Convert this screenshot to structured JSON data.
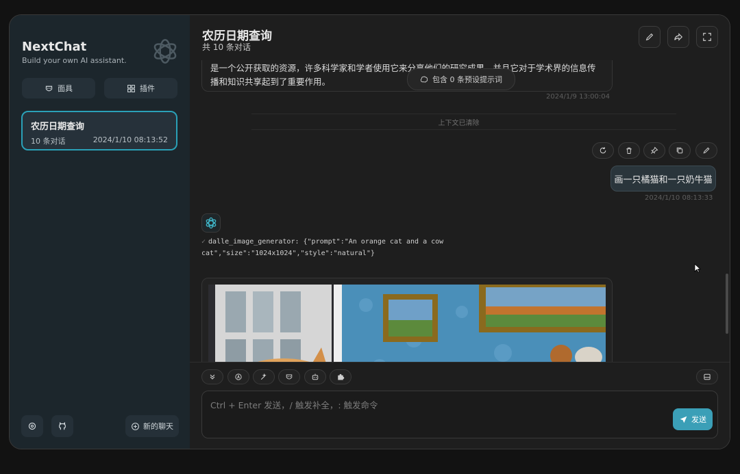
{
  "sidebar": {
    "brand_title": "NextChat",
    "brand_subtitle": "Build your own AI assistant.",
    "mask_button": "面具",
    "plugin_button": "插件",
    "chat_card": {
      "title": "农历日期查询",
      "count": "10 条对话",
      "time": "2024/1/10 08:13:52"
    },
    "new_chat_button": "新的聊天"
  },
  "header": {
    "title": "农历日期查询",
    "subtitle": "共 10 条对话"
  },
  "messages": {
    "prev_bot_text": "是一个公开获取的资源，许多科学家和学者使用它来分享他们的研究成果，并且它对于学术界的信息传播和知识共享起到了重要作用。",
    "prev_bot_time": "2024/1/9 13:00:04",
    "prompt_pill": "包含 0 条预设提示词",
    "context_cleared": "上下文已清除",
    "user_text": "画一只橘猫和一只奶牛猫",
    "user_time": "2024/1/10 08:13:33",
    "tool_call": "dalle_image_generator: {\"prompt\":\"An orange cat and a cow cat\",\"size\":\"1024x1024\",\"style\":\"natural\"}"
  },
  "input": {
    "placeholder": "Ctrl + Enter 发送，/ 触发补全，: 触发命令",
    "send_label": "发送"
  },
  "colors": {
    "accent": "#3b9fb7",
    "sidebar_bg": "#1c262c",
    "main_bg": "#1e1e1e"
  }
}
